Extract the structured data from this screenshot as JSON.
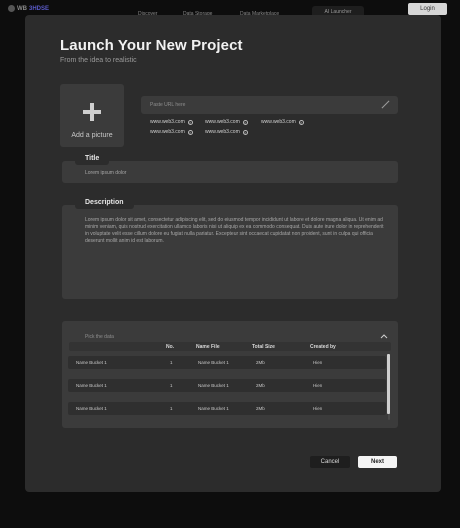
{
  "topbar": {
    "logo_prefix": "WB",
    "logo_accent": "3HDSE",
    "nav": [
      "Discover",
      "Data Storage",
      "Data Marketplace",
      "AI Launcher"
    ],
    "login": "Login"
  },
  "modal": {
    "title": "Launch Your New Project",
    "subtitle": "From the idea to realistic",
    "add_picture": "Add a picture",
    "url_placeholder": "Paste URL here",
    "urls": [
      "www.web3.com",
      "www.web3.com",
      "www.web3.com",
      "www.web3.com",
      "www.web3.com"
    ],
    "title_label": "Title",
    "title_value": "Lorem ipsum dolor",
    "description_label": "Description",
    "description_value": "Lorem ipsum dolor sit amet, consectetur adipiscing elit, sed do eiusmod tempor incididunt ut labore et dolore magna aliqua. Ut enim ad minim veniam, quis nostrud exercitation ullamco laboris nisi ut aliquip ex ea commodo consequat. Duis aute irure dolor in reprehenderit in voluptate velit esse cillum dolore eu fugiat nulla pariatur. Excepteur sint occaecat cupidatat non proident, sunt in culpa qui officia deserunt mollit anim id est laborum.",
    "pick_data": "Pick the data",
    "table": {
      "headers": [
        "No.",
        "Name File",
        "Total Size",
        "Created by"
      ],
      "rows": [
        {
          "name": "Name Bucket 1",
          "no": "1",
          "file": "Name Bucket 1",
          "size": "2Mb",
          "by": "Hien"
        },
        {
          "name": "Name Bucket 1",
          "no": "1",
          "file": "Name Bucket 1",
          "size": "2Mb",
          "by": "Hien"
        },
        {
          "name": "Name Bucket 1",
          "no": "1",
          "file": "Name Bucket 1",
          "size": "2Mb",
          "by": "Hien"
        }
      ]
    },
    "cancel": "Cancel",
    "next": "Next"
  },
  "colors": {
    "background": "#0d0d0d",
    "modal": "#2c2c2c",
    "field": "#3b3b3b",
    "primary_button": "#f4f4f4"
  }
}
